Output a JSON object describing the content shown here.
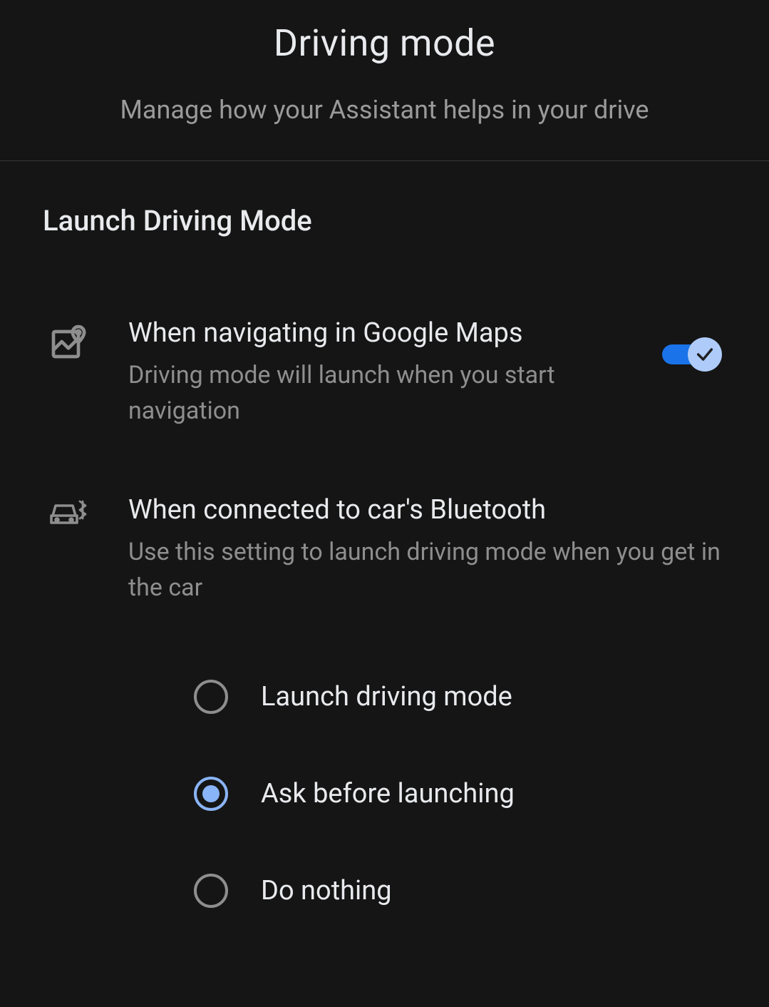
{
  "header": {
    "title": "Driving mode",
    "subtitle": "Manage how your Assistant helps in your drive"
  },
  "section": {
    "title": "Launch Driving Mode",
    "maps": {
      "title": "When navigating in Google Maps",
      "subtitle": "Driving mode will launch when you start navigation",
      "enabled": true
    },
    "bluetooth": {
      "title": "When connected to car's Bluetooth",
      "subtitle": "Use this setting to launch driving mode when you get in the car",
      "options": [
        {
          "label": "Launch driving mode",
          "selected": false
        },
        {
          "label": "Ask before launching",
          "selected": true
        },
        {
          "label": "Do nothing",
          "selected": false
        }
      ]
    }
  }
}
